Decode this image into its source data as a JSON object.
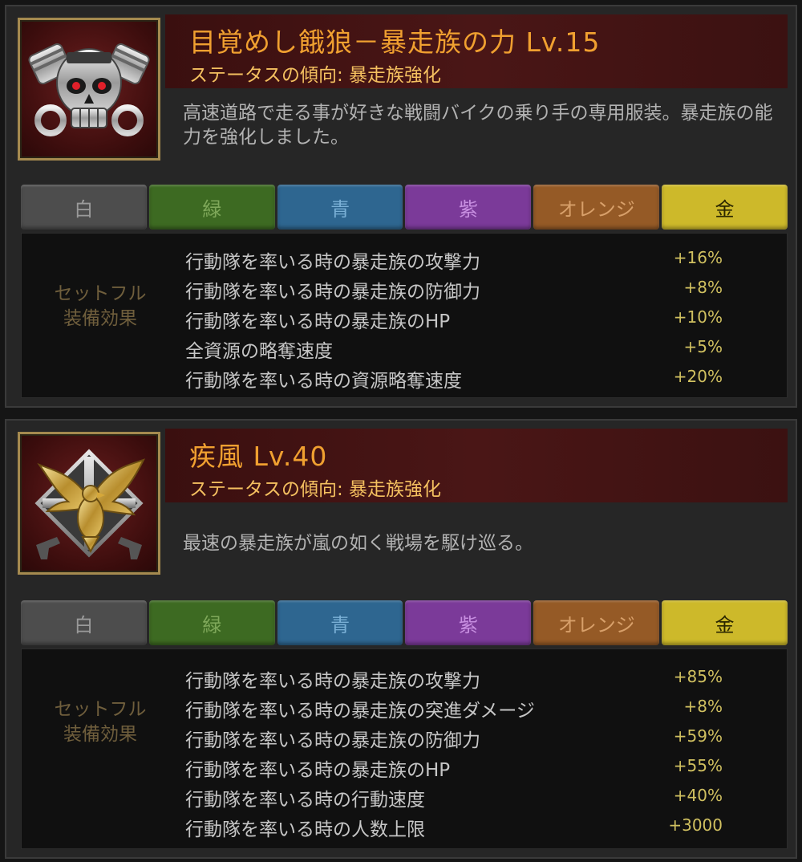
{
  "items": [
    {
      "icon": "skull-pistons-icon",
      "title": "目覚めし餓狼－暴走族の力 Lv.15",
      "trend": "ステータスの傾向:  暴走族強化",
      "description": "高速道路で走る事が好きな戦闘バイクの乗り手の専用服装。暴走族の能力を強化しました。",
      "tiers": [
        {
          "label": "白",
          "color": "#4d4d4d"
        },
        {
          "label": "緑",
          "color": "#3d6a22"
        },
        {
          "label": "青",
          "color": "#2e6690"
        },
        {
          "label": "紫",
          "color": "#7b3a99"
        },
        {
          "label": "オレンジ",
          "color": "#955a26"
        },
        {
          "label": "金",
          "color": "#cdb92a"
        }
      ],
      "effects_label": "セットフル\n装備効果",
      "effects": [
        {
          "name": "行動隊を率いる時の暴走族の攻撃力",
          "value": "+16%"
        },
        {
          "name": "行動隊を率いる時の暴走族の防御力",
          "value": "+8%"
        },
        {
          "name": "行動隊を率いる時の暴走族のHP",
          "value": "+10%"
        },
        {
          "name": "全資源の略奪速度",
          "value": "+5%"
        },
        {
          "name": "行動隊を率いる時の資源略奪速度",
          "value": "+20%"
        }
      ]
    },
    {
      "icon": "eagle-emblem-icon",
      "title": "疾風 Lv.40",
      "trend": "ステータスの傾向:  暴走族強化",
      "description": "最速の暴走族が嵐の如く戦場を駆け巡る。",
      "tiers": [
        {
          "label": "白",
          "color": "#4d4d4d"
        },
        {
          "label": "緑",
          "color": "#3d6a22"
        },
        {
          "label": "青",
          "color": "#2e6690"
        },
        {
          "label": "紫",
          "color": "#7b3a99"
        },
        {
          "label": "オレンジ",
          "color": "#955a26"
        },
        {
          "label": "金",
          "color": "#cdb92a"
        }
      ],
      "effects_label": "セットフル\n装備効果",
      "effects": [
        {
          "name": "行動隊を率いる時の暴走族の攻撃力",
          "value": "+85%"
        },
        {
          "name": "行動隊を率いる時の暴走族の突進ダメージ",
          "value": "+8%"
        },
        {
          "name": "行動隊を率いる時の暴走族の防御力",
          "value": "+59%"
        },
        {
          "name": "行動隊を率いる時の暴走族のHP",
          "value": "+55%"
        },
        {
          "name": "行動隊を率いる時の行動速度",
          "value": "+40%"
        },
        {
          "name": "行動隊を率いる時の人数上限",
          "value": "+3000"
        }
      ]
    }
  ]
}
